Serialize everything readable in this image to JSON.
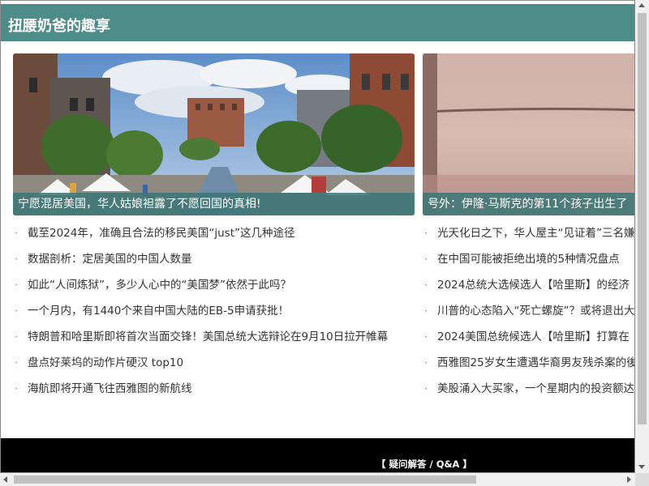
{
  "header": {
    "title": "扭腰奶爸的趣享"
  },
  "featured": [
    {
      "caption": "宁愿混居美国，华人姑娘袒露了不愿回国的真相!"
    },
    {
      "caption": "号外：伊隆·马斯克的第11个孩子出生了"
    }
  ],
  "bullet": "·",
  "news_col1": [
    "截至2024年，准确且合法的移民美国“just”这几种途径",
    "数据剖析：定居美国的中国人数量",
    "如此“人间炼狱”，多少人心中的“美国梦”依然于此吗？",
    "一个月内，有1440个来自中国大陆的EB-5申请获批！",
    "特朗普和哈里斯即将首次当面交锋！美国总统大选辩论在9月10日拉开帷幕",
    "盘点好莱坞的动作片硬汉 top10",
    "海航即将开通飞往西雅图的新航线"
  ],
  "news_col2": [
    "光天化日之下，华人屋主“见证着”三名嫌",
    "在中国可能被拒绝出境的5种情况盘点",
    "2024总统大选候选人【哈里斯】的经济",
    "川普的心态陷入“死亡螺旋”？或将退出大",
    "2024美国总统候选人【哈里斯】打算在",
    "西雅图25岁女生遭遇华裔男友残杀案的後",
    "美股涌入大买家，一个星期内的投资额达"
  ],
  "footer": {
    "link": "【 疑问解答 / Q&A 】"
  },
  "colors": {
    "header_bg": "#4e8c89",
    "caption_bg": "#3d7676",
    "footer_bg": "#000000",
    "text": "#333333"
  }
}
